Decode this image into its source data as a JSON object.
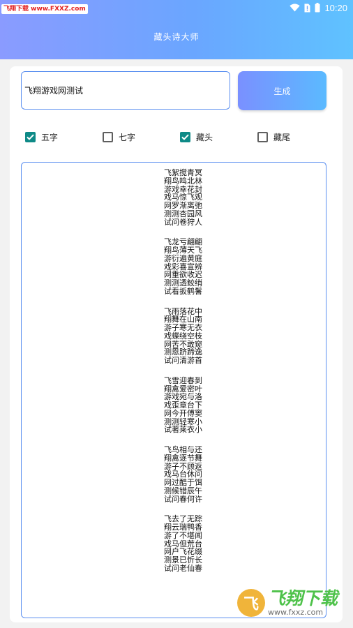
{
  "status_bar": {
    "watermark": "飞翔下载 www.FXXZ.com",
    "time": "10:20"
  },
  "header": {
    "title": "藏头诗大师"
  },
  "input": {
    "value": "飞翔游戏网测试"
  },
  "generate_button": {
    "label": "生成"
  },
  "options": [
    {
      "label": "五字",
      "checked": true
    },
    {
      "label": "七字",
      "checked": false
    },
    {
      "label": "藏头",
      "checked": true
    },
    {
      "label": "藏尾",
      "checked": false
    }
  ],
  "poems": [
    [
      "飞絮搅青冥",
      "翔鸟鸣北林",
      "游戏幸花封",
      "戏马惊飞观",
      "网罗渐离弛",
      "测测杏园风",
      "试问卷狩人"
    ],
    [
      "飞龙亏翩翩",
      "翔鸟薄天飞",
      "游衍遍黄庭",
      "戏彩喜宣辨",
      "网重欲收迟",
      "测测透鲛绡",
      "试看扳鹤鬐"
    ],
    [
      "飞雨落花中",
      "翔舞在山南",
      "游子寒无衣",
      "戏蝶绕空枝",
      "网苦不敢窥",
      "测恩跻蹄逸",
      "试问清游首"
    ],
    [
      "飞雪迎春到",
      "翔禽爱密叶",
      "游戏宛与洛",
      "戏歪章台下",
      "网今开傅窦",
      "测测轻寒小",
      "试著莱衣小"
    ],
    [
      "飞鸟相与还",
      "翔禽逐节舞",
      "游子不顾返",
      "戏马台休问",
      "网过酷于饵",
      "测候错辰午",
      "试问春何许"
    ],
    [
      "飞去了无踪",
      "翔云瑞鸭香",
      "游了不堪闻",
      "戏马但荒台",
      "网户飞花缀",
      "测景已忻长",
      "试问老仙春"
    ]
  ],
  "watermark_bottom": {
    "logo_text": "飞",
    "main": "飞翔下载",
    "url": "www.fxxz.com"
  },
  "colors": {
    "checkbox_checked": "#0e8a87",
    "accent_border": "#5b8ff0",
    "header_gradient_start": "#8a9bff",
    "header_gradient_end": "#5fc2ff"
  }
}
